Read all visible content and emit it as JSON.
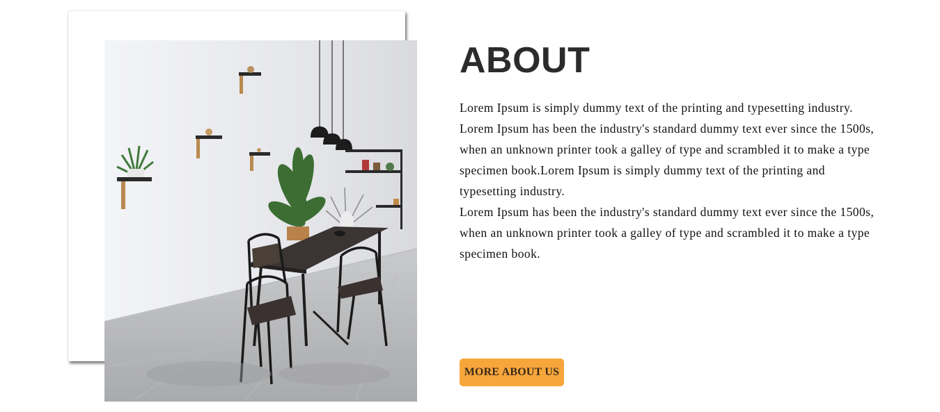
{
  "about": {
    "title": "ABOUT",
    "paragraphs": [
      "Lorem Ipsum is simply dummy text of the printing and typesetting industry.",
      "Lorem Ipsum has been the industry's standard dummy text ever since the 1500s,",
      "when an unknown printer took a galley of type and scrambled it to make a type specimen book.Lorem Ipsum is simply dummy text of the printing and typesetting industry.",
      "Lorem Ipsum has been the industry's standard dummy text ever since the 1500s,",
      "when an unknown printer took a galley of type and scrambled it to make a type specimen book."
    ],
    "button_label": "MORE ABOUT US"
  },
  "colors": {
    "accent": "#f7a63c",
    "title": "#2b2b2b",
    "text": "#111111"
  }
}
